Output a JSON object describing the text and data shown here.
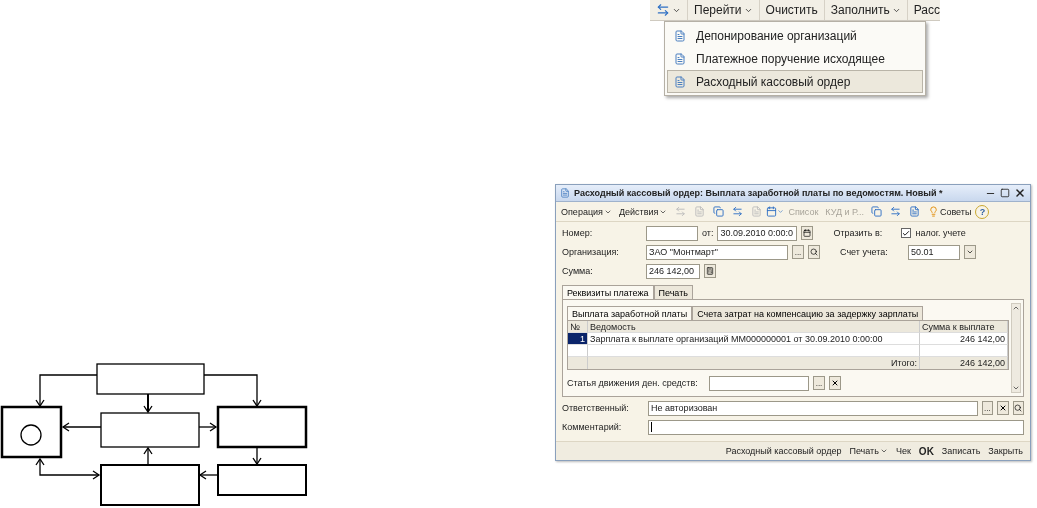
{
  "menu_snippet": {
    "toolbar": [
      {
        "kind": "icon",
        "dropdown": true
      },
      {
        "kind": "text",
        "label": "Перейти",
        "dropdown": true
      },
      {
        "kind": "text",
        "label": "Очистить",
        "dropdown": false
      },
      {
        "kind": "text",
        "label": "Заполнить",
        "dropdown": true
      },
      {
        "kind": "text",
        "label": "Расс",
        "dropdown": false
      }
    ],
    "items": [
      {
        "label": "Депонирование организаций",
        "selected": false
      },
      {
        "label": "Платежное поручение исходящее",
        "selected": false
      },
      {
        "label": "Расходный кассовый ордер",
        "selected": true
      }
    ]
  },
  "window": {
    "title": "Расходный кассовый ордер: Выплата заработной платы по ведомостям. Новый *",
    "toolbar": [
      {
        "kind": "text",
        "label": "Операция",
        "dropdown": true,
        "disabled": false
      },
      {
        "kind": "text",
        "label": "Действия",
        "dropdown": true,
        "disabled": false
      },
      {
        "kind": "icon",
        "disabled": true
      },
      {
        "kind": "icon",
        "disabled": true
      },
      {
        "kind": "icon",
        "disabled": false
      },
      {
        "kind": "icon",
        "disabled": false
      },
      {
        "kind": "icon",
        "disabled": true
      },
      {
        "kind": "icon",
        "dropdown": true,
        "disabled": false
      },
      {
        "kind": "text",
        "label": "Список",
        "dropdown": false,
        "disabled": true
      },
      {
        "kind": "text",
        "label": "КУД и Р...",
        "dropdown": false,
        "disabled": true
      },
      {
        "kind": "icon",
        "disabled": false
      },
      {
        "kind": "icon",
        "disabled": false
      },
      {
        "kind": "icon",
        "disabled": false
      },
      {
        "kind": "text",
        "label": "Советы",
        "icon": true,
        "dropdown": false,
        "disabled": false
      },
      {
        "kind": "help",
        "label": "?",
        "disabled": false
      }
    ],
    "number": {
      "label": "Номер:",
      "date_label": "от:",
      "date": "30.09.2010  0:00:0"
    },
    "reflect": {
      "label": "Отразить в:",
      "option": "налог. учете",
      "checked": true
    },
    "organization": {
      "label": "Организация:",
      "value": "ЗАО \"Монтмарт\"",
      "pick": "..."
    },
    "account": {
      "label": "Счет учета:",
      "value": "50.01"
    },
    "sum": {
      "label": "Сумма:",
      "value": "246 142,00"
    },
    "tabs": [
      {
        "label": "Реквизиты платежа",
        "selected": true
      },
      {
        "label": "Печать",
        "selected": false
      }
    ],
    "subtabs": [
      {
        "label": "Выплата заработной платы",
        "selected": true
      },
      {
        "label": "Счета затрат на компенсацию за задержку зарплаты",
        "selected": false
      }
    ],
    "table": {
      "columns": [
        "№",
        "Ведомость",
        "Сумма к выплате"
      ],
      "rows": [
        {
          "cells": [
            "1",
            "Зарплата к выплате организаций ММ000000001 от 30.09.2010 0:00:00",
            "246 142,00"
          ],
          "selected": true
        }
      ],
      "total_label": "Итого:",
      "total_value": "246 142,00"
    },
    "cash_flow": {
      "label": "Статья движения ден. средств:",
      "pick": "..."
    },
    "responsible": {
      "label": "Ответственный:",
      "value": "Не авторизован",
      "pick": "..."
    },
    "comment": {
      "label": "Комментарий:"
    },
    "buttons": [
      {
        "label": "Расходный кассовый ордер",
        "dropdown": false,
        "default": false
      },
      {
        "label": "Печать",
        "dropdown": true,
        "default": false
      },
      {
        "label": "Чек",
        "dropdown": false,
        "default": false
      },
      {
        "label": "OK",
        "dropdown": false,
        "default": true
      },
      {
        "label": "Записать",
        "dropdown": false,
        "default": false
      },
      {
        "label": "Закрыть",
        "dropdown": false,
        "default": false
      }
    ]
  }
}
